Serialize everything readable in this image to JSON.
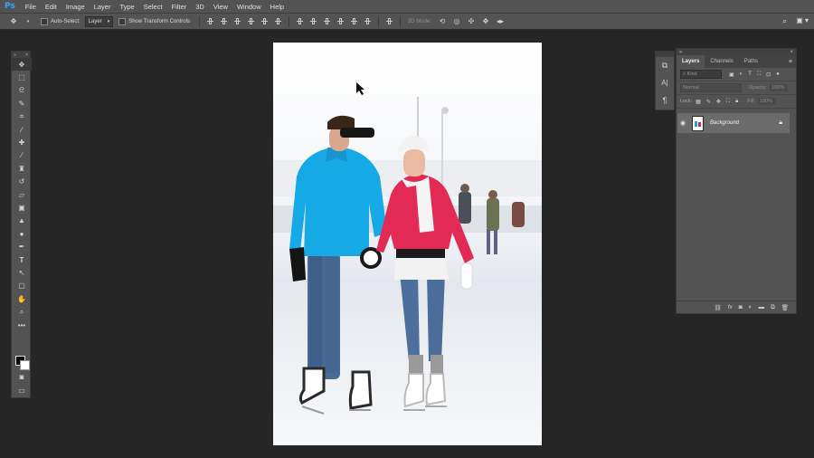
{
  "app": {
    "logo": "Ps"
  },
  "menu": [
    "File",
    "Edit",
    "Image",
    "Layer",
    "Type",
    "Select",
    "Filter",
    "3D",
    "View",
    "Window",
    "Help"
  ],
  "options": {
    "auto_select_label": "Auto-Select:",
    "auto_select_value": "Layer",
    "transform_controls_label": "Show Transform Controls",
    "mode_label": "3D Mode:"
  },
  "layers_panel": {
    "tabs": [
      "Layers",
      "Channels",
      "Paths"
    ],
    "kind_placeholder": "Kind",
    "blend_mode": "Normal",
    "opacity_label": "Opacity:",
    "opacity_value": "100%",
    "lock_label": "Lock:",
    "fill_label": "Fill:",
    "fill_value": "100%",
    "layer_name": "Background"
  },
  "colors": {
    "accent": "#31a8ff",
    "panel": "#535353",
    "canvas_bg": "#262626"
  },
  "icons": {
    "tools": [
      "move-icon",
      "marquee-icon",
      "lasso-icon",
      "quick-select-icon",
      "crop-icon",
      "eyedropper-icon",
      "healing-brush-icon",
      "brush-icon",
      "clone-stamp-icon",
      "history-brush-icon",
      "eraser-icon",
      "gradient-icon",
      "blur-icon",
      "dodge-icon",
      "pen-icon",
      "type-icon",
      "path-select-icon",
      "shape-icon",
      "hand-icon",
      "zoom-icon",
      "more-tools-icon"
    ]
  }
}
